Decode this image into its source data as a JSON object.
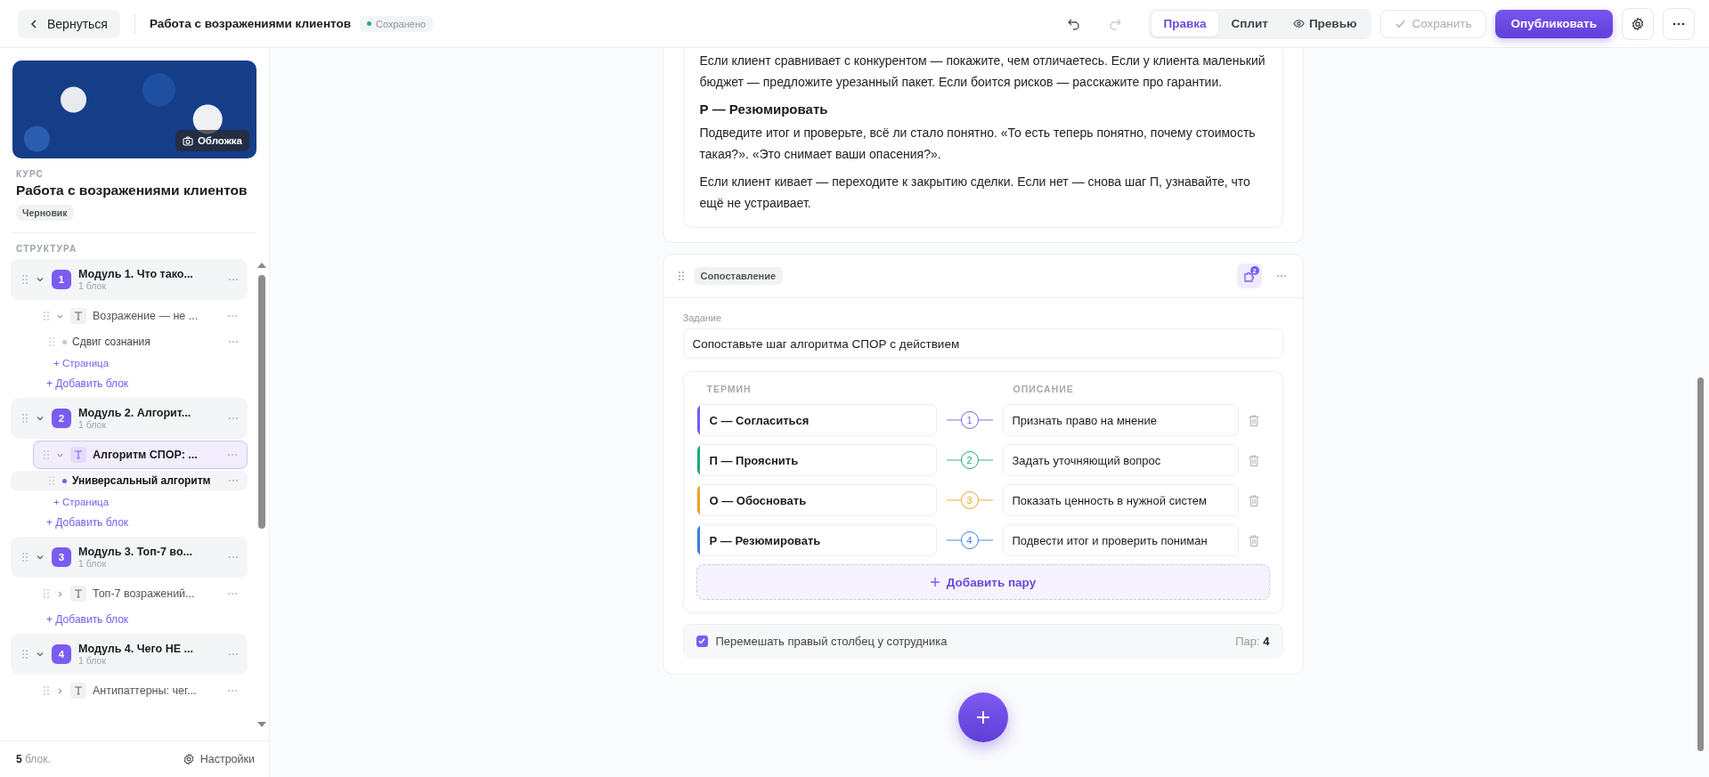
{
  "topbar": {
    "back_button": "Вернуться",
    "title": "Работа с возражениями клиентов",
    "save_status": "Сохранено",
    "undo_disabled": false,
    "redo_disabled": true,
    "view_tabs": [
      {
        "label": "Правка",
        "selected": true
      },
      {
        "label": "Сплит",
        "selected": false
      },
      {
        "label": "Превью",
        "selected": false
      }
    ],
    "save_button": {
      "label": "Сохранить",
      "disabled": true
    },
    "publish_button": "Опубликовать"
  },
  "sidebar": {
    "cover_button": "Обложка",
    "course_label": "КУРС",
    "course_title": "Работа с возражениями клиентов",
    "status_badge": "Черновик",
    "structure_label": "СТРУКТУРА",
    "modules": [
      {
        "number": "1",
        "title": "Модуль 1. Что тако...",
        "meta": "1 блок",
        "expanded": true,
        "children": [
          {
            "title": "Возражение — не ...",
            "expanded": true,
            "selected": false,
            "pages": [
              {
                "title": "Сдвиг сознания",
                "selected": false
              }
            ],
            "add_page": "+ Страница"
          }
        ],
        "add_block": "+ Добавить блок"
      },
      {
        "number": "2",
        "title": "Модуль 2. Алгорит...",
        "meta": "1 блок",
        "expanded": true,
        "children": [
          {
            "title": "Алгоритм СПОР: ...",
            "expanded": true,
            "selected": true,
            "pages": [
              {
                "title": "Универсальный алгоритм",
                "selected": true
              }
            ],
            "add_page": "+ Страница"
          }
        ],
        "add_block": "+ Добавить блок"
      },
      {
        "number": "3",
        "title": "Модуль 3. Топ-7 во...",
        "meta": "1 блок",
        "expanded": true,
        "children": [
          {
            "title": "Топ-7 возражений...",
            "expanded": false,
            "selected": false
          }
        ],
        "add_block": "+ Добавить блок"
      },
      {
        "number": "4",
        "title": "Модуль 4. Чего НЕ ...",
        "meta": "1 блок",
        "expanded": true,
        "children": [
          {
            "title": "Антипаттерны: чег...",
            "expanded": false,
            "selected": false
          }
        ]
      }
    ],
    "footer_count": "**5** блок.",
    "settings_button": "Настройки"
  },
  "text_block": {
    "content": [
      {
        "kind": "paragraph",
        "text": "Если клиент сравнивает с конкурентом — покажите, чем отличаетесь. Если у клиента маленький бюджет — предложите урезанный пакет. Если боится рисков — расскажите про гарантии."
      },
      {
        "kind": "heading",
        "text": "Р — Резюмировать"
      },
      {
        "kind": "paragraph",
        "text": "Подведите итог и проверьте, всё ли стало понятно. «То есть теперь понятно, почему стоимость такая?». «Это снимает ваши опасения?»."
      },
      {
        "kind": "paragraph",
        "text": "Если клиент кивает — переходите к закрытию сделки. Если нет — снова шаг П, узнавайте, что ещё не устраивает."
      }
    ]
  },
  "matching_block": {
    "type_label": "Сопоставление",
    "ai_badge": "2",
    "task_label": "Задание",
    "task_value": "Сопоставьте шаг алгоритма СПОР с действием",
    "columns": [
      "ТЕРМИН",
      "ОПИСАНИЕ"
    ],
    "pairs": [
      {
        "number": "1",
        "term": "С — Согласиться",
        "description": "Признать право на мнение",
        "color": "#7b5cf0"
      },
      {
        "number": "2",
        "term": "П — Прояснить",
        "description": "Задать уточняющий вопрос",
        "color": "#1faa7c"
      },
      {
        "number": "3",
        "term": "О — Обосновать",
        "description": "Показать ценность в нужной систем",
        "color": "#f0a323"
      },
      {
        "number": "4",
        "term": "Р — Резюмировать",
        "description": "Подвести итог и проверить пониман",
        "color": "#3b7ce6"
      }
    ],
    "add_pair_button": "Добавить пару",
    "shuffle": {
      "label": "Перемешать правый столбец у сотрудника",
      "checked": true
    },
    "pair_count": "Пар: **4**"
  }
}
